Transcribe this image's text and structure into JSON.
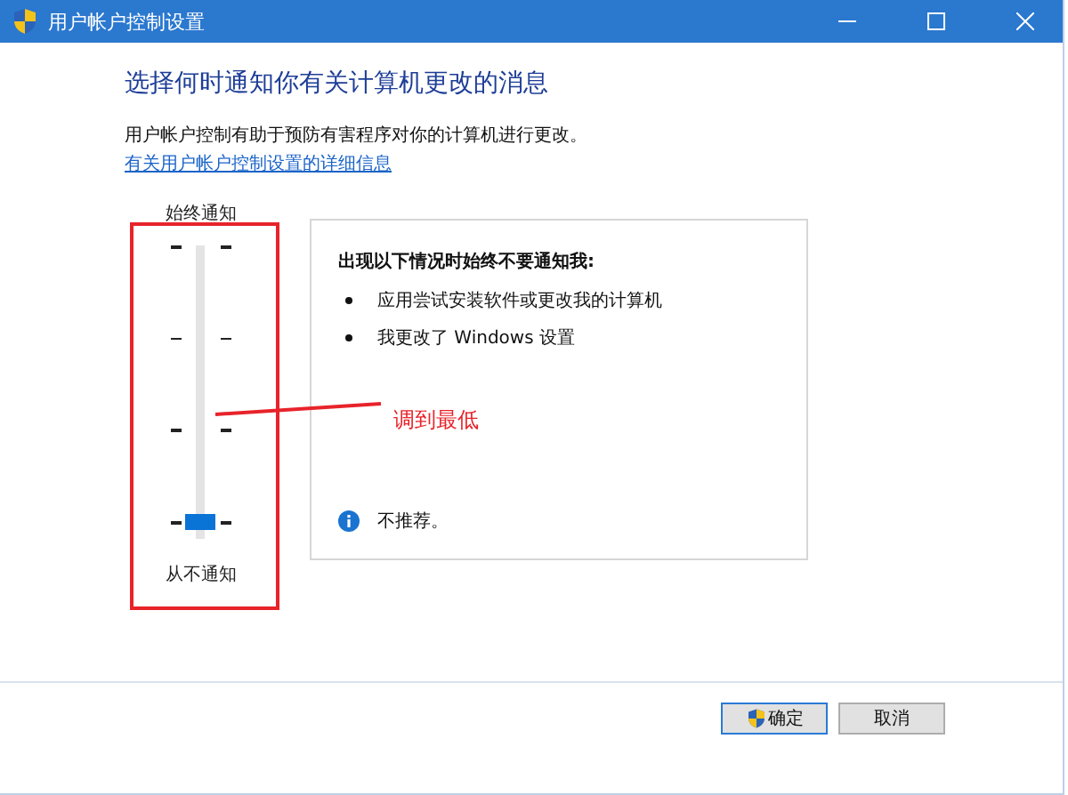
{
  "window": {
    "title": "用户帐户控制设置"
  },
  "heading": "选择何时通知你有关计算机更改的消息",
  "description": "用户帐户控制有助于预防有害程序对你的计算机进行更改。",
  "link": "有关用户帐户控制设置的详细信息",
  "slider": {
    "top_label": "始终通知",
    "bottom_label": "从不通知",
    "level": 0
  },
  "info_box": {
    "title": "出现以下情况时始终不要通知我:",
    "bullets": [
      "应用尝试安装软件或更改我的计算机",
      "我更改了 Windows 设置"
    ],
    "note": "不推荐。"
  },
  "annotation": {
    "text": "调到最低"
  },
  "buttons": [
    {
      "label": "确定",
      "kind": "primary"
    },
    {
      "label": "取消",
      "kind": "normal"
    }
  ]
}
